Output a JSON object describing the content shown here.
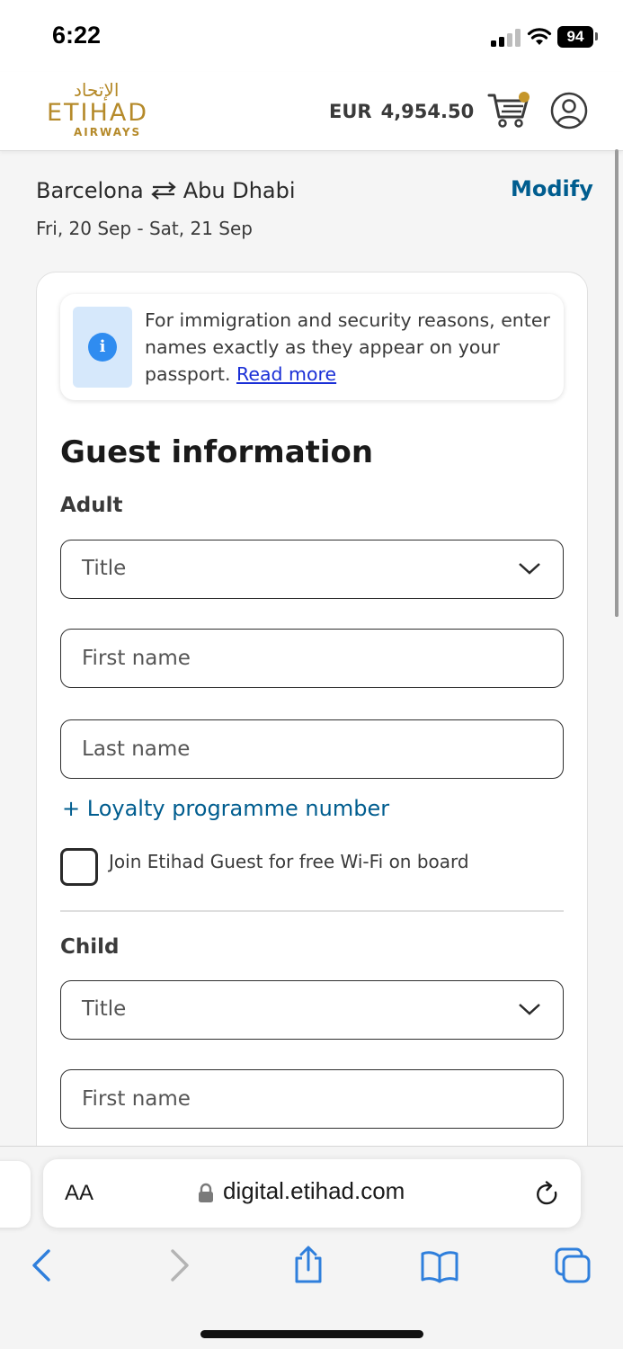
{
  "status_bar": {
    "time": "6:22",
    "battery": "94"
  },
  "header": {
    "logo": {
      "arabic": "الإتحاد",
      "name": "ETIHAD",
      "sub": "AIRWAYS"
    },
    "cart": {
      "currency": "EUR",
      "amount": "4,954.50",
      "badge_color": "#c5962a"
    },
    "icons": {
      "cart": "shopping-cart-icon",
      "profile": "user-profile-icon"
    }
  },
  "trip": {
    "origin": "Barcelona",
    "destination": "Abu Dhabi",
    "dates": "Fri, 20 Sep - Sat, 21 Sep",
    "modify_label": "Modify"
  },
  "notice": {
    "text": "For immigration and security reasons, enter names exactly as they appear on your passport.",
    "link_label": "Read more",
    "icon": "info-icon"
  },
  "form": {
    "heading": "Guest information",
    "adult": {
      "label": "Adult",
      "title_placeholder": "Title",
      "first_name_placeholder": "First name",
      "last_name_placeholder": "Last name",
      "loyalty_label": "+ Loyalty programme number",
      "join_label": "Join Etihad Guest for free Wi-Fi on board"
    },
    "child": {
      "label": "Child",
      "title_placeholder": "Title",
      "first_name_placeholder": "First name"
    }
  },
  "browser": {
    "aa_label": "AA",
    "url": "digital.etihad.com"
  },
  "colors": {
    "brand_gold": "#b58a2a",
    "link_blue": "#005d8f",
    "ios_blue": "#2f7fdc",
    "info_blue": "#2f8cf0"
  }
}
